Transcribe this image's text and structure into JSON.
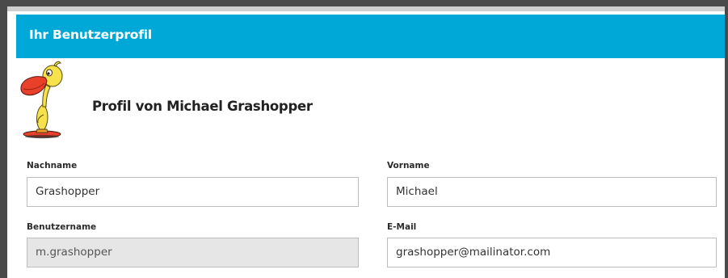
{
  "panel": {
    "title": "Ihr Benutzerprofil"
  },
  "profile": {
    "heading": "Profil von Michael Grashopper",
    "avatar_icon": "duck-mascot-icon"
  },
  "fields": {
    "lastname": {
      "label": "Nachname",
      "value": "Grashopper"
    },
    "firstname": {
      "label": "Vorname",
      "value": "Michael"
    },
    "username": {
      "label": "Benutzername",
      "value": "m.grashopper"
    },
    "email": {
      "label": "E-Mail",
      "value": "grashopper@mailinator.com"
    }
  },
  "colors": {
    "header_bg": "#00a8d8",
    "frame": "#4a4a4a",
    "readonly_bg": "#e6e6e6"
  }
}
